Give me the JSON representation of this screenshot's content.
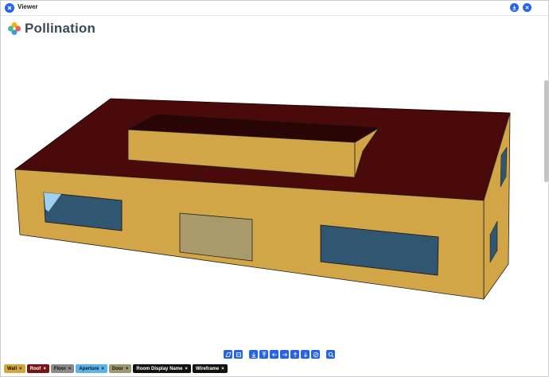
{
  "window": {
    "title": "Viewer"
  },
  "brand": {
    "name": "Pollination"
  },
  "legend": [
    {
      "label": "Wall",
      "color": "#d4a73a",
      "dark": false
    },
    {
      "label": "Roof",
      "color": "#7a1414",
      "dark": true
    },
    {
      "label": "Floor",
      "color": "#8a8a8a",
      "dark": false
    },
    {
      "label": "Aperture",
      "color": "#5ab4ea",
      "dark": false
    },
    {
      "label": "Door",
      "color": "#9e9872",
      "dark": false
    },
    {
      "label": "Room Display Name",
      "color": "#111111",
      "dark": true
    },
    {
      "label": "Wireframe",
      "color": "#111111",
      "dark": true
    }
  ],
  "close_glyph": "×",
  "colors": {
    "accent": "#2563eb",
    "wall": "#d2a646",
    "roof": "#4a0a0a",
    "aperture": "#315672",
    "door": "#a89a6a"
  },
  "toolbar_icons": [
    "perspective-icon",
    "orthographic-icon",
    "view-bottom-icon",
    "view-top-icon",
    "view-left-icon",
    "view-right-icon",
    "view-front-icon",
    "view-back-icon",
    "view-iso-icon",
    "zoom-fit-icon"
  ]
}
